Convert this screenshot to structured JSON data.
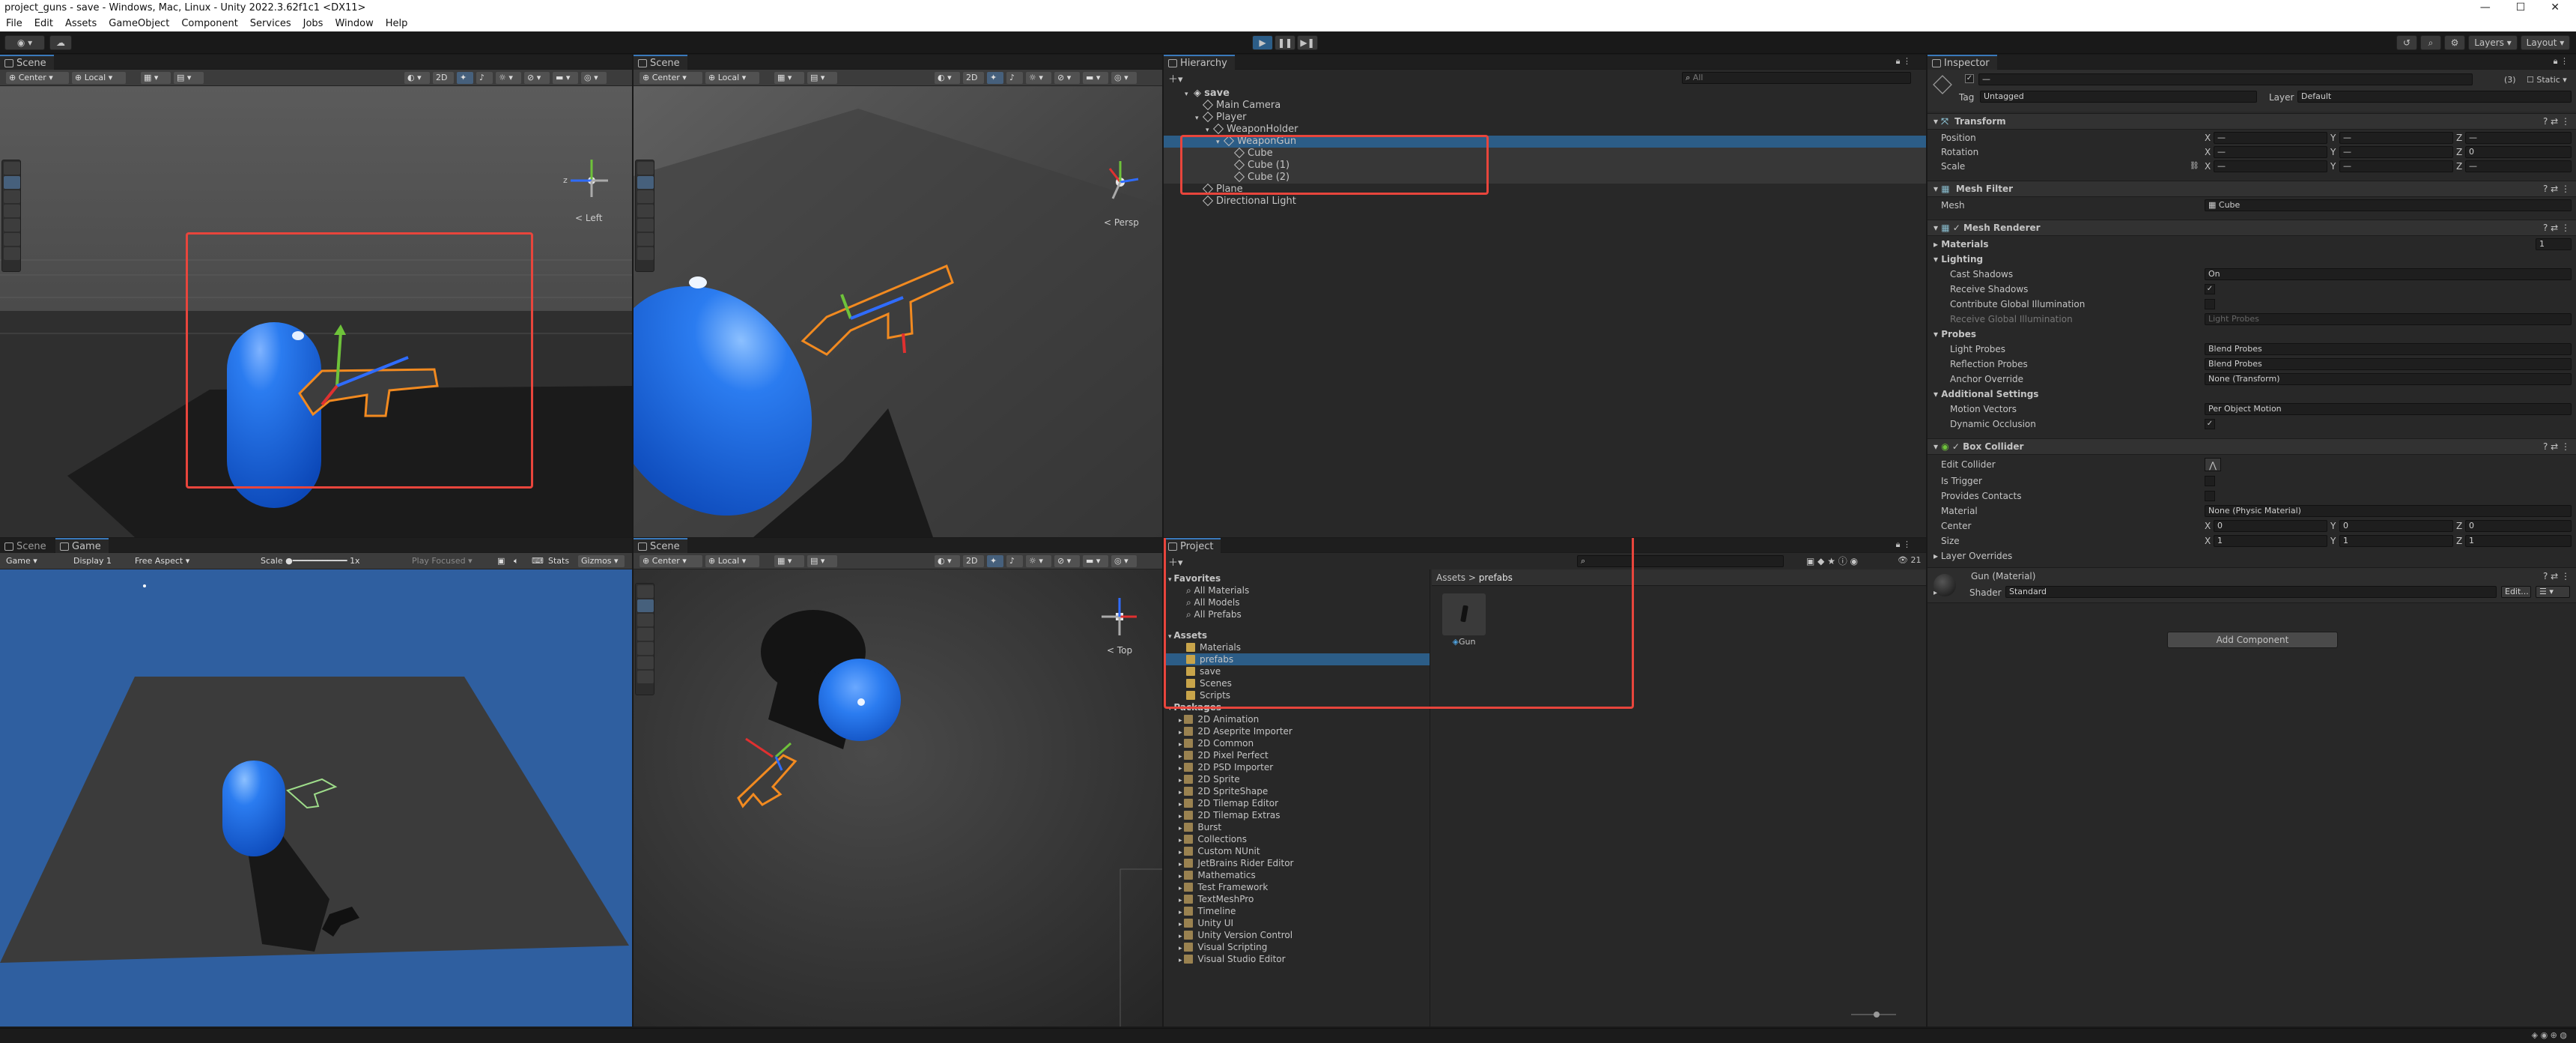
{
  "window": {
    "title": "project_guns - save - Windows, Mac, Linux - Unity 2022.3.62f1c1 <DX11>",
    "min": "—",
    "max": "☐",
    "close": "✕"
  },
  "menu": [
    "File",
    "Edit",
    "Assets",
    "GameObject",
    "Component",
    "Services",
    "Jobs",
    "Window",
    "Help"
  ],
  "toolbar": {
    "layers": "Layers",
    "layout": "Layout"
  },
  "scene_tl": {
    "tab": "Scene",
    "pivot": "Center",
    "space": "Local",
    "mode2d": "2D",
    "view": "< Left"
  },
  "scene_tr": {
    "tab": "Scene",
    "pivot": "Center",
    "space": "Local",
    "mode2d": "2D",
    "view": "< Persp"
  },
  "scene_br": {
    "tab": "Scene",
    "pivot": "Center",
    "space": "Local",
    "mode2d": "2D",
    "view": "< Top"
  },
  "game": {
    "tab_scene": "Scene",
    "tab_game": "Game",
    "display_mode": "Game",
    "display": "Display 1",
    "aspect": "Free Aspect",
    "scale_label": "Scale",
    "scale_value": "1x",
    "play_focused": "Play Focused",
    "stats": "Stats",
    "gizmos": "Gizmos"
  },
  "hierarchy": {
    "tab": "Hierarchy",
    "search_placeholder": "All",
    "items": [
      {
        "label": "save",
        "depth": 0,
        "kind": "scene"
      },
      {
        "label": "Main Camera",
        "depth": 1,
        "kind": "go"
      },
      {
        "label": "Player",
        "depth": 1,
        "kind": "go"
      },
      {
        "label": "WeaponHolder",
        "depth": 2,
        "kind": "go"
      },
      {
        "label": "WeaponGun",
        "depth": 3,
        "kind": "go"
      },
      {
        "label": "Cube",
        "depth": 4,
        "kind": "go"
      },
      {
        "label": "Cube (1)",
        "depth": 4,
        "kind": "go"
      },
      {
        "label": "Cube (2)",
        "depth": 4,
        "kind": "go"
      },
      {
        "label": "Plane",
        "depth": 1,
        "kind": "go"
      },
      {
        "label": "Directional Light",
        "depth": 1,
        "kind": "go"
      }
    ]
  },
  "project": {
    "tab": "Project",
    "count": "21",
    "breadcrumb_root": "Assets",
    "breadcrumb_sep": ">",
    "breadcrumb_leaf": "prefabs",
    "asset_name": "Gun",
    "favorites_label": "Favorites",
    "favorites": [
      "All Materials",
      "All Models",
      "All Prefabs"
    ],
    "assets_label": "Assets",
    "assets": [
      "Materials",
      "prefabs",
      "save",
      "Scenes",
      "Scripts"
    ],
    "packages_label": "Packages",
    "packages": [
      "2D Animation",
      "2D Aseprite Importer",
      "2D Common",
      "2D Pixel Perfect",
      "2D PSD Importer",
      "2D Sprite",
      "2D SpriteShape",
      "2D Tilemap Editor",
      "2D Tilemap Extras",
      "Burst",
      "Collections",
      "Custom NUnit",
      "JetBrains Rider Editor",
      "Mathematics",
      "Test Framework",
      "TextMeshPro",
      "Timeline",
      "Unity UI",
      "Unity Version Control",
      "Visual Scripting",
      "Visual Studio Editor"
    ]
  },
  "inspector": {
    "tab": "Inspector",
    "name": "—",
    "static": "Static",
    "badge": "(3)",
    "tag_label": "Tag",
    "tag": "Untagged",
    "layer_label": "Layer",
    "layer": "Default",
    "transform": {
      "title": "Transform",
      "position": "Position",
      "rotation": "Rotation",
      "scale": "Scale",
      "dash": "—",
      "rz": "0",
      "x": "X",
      "y": "Y",
      "z": "Z"
    },
    "mesh_filter": {
      "title": "Mesh Filter",
      "mesh_label": "Mesh",
      "mesh": "Cube"
    },
    "mesh_renderer": {
      "title": "Mesh Renderer",
      "materials": "Materials",
      "materials_count": "1",
      "lighting": "Lighting",
      "cast_shadows": "Cast Shadows",
      "cast_shadows_val": "On",
      "receive_shadows": "Receive Shadows",
      "contribute_gi": "Contribute Global Illumination",
      "receive_gi": "Receive Global Illumination",
      "receive_gi_val": "Light Probes",
      "probes": "Probes",
      "light_probes": "Light Probes",
      "light_probes_val": "Blend Probes",
      "reflection_probes": "Reflection Probes",
      "reflection_probes_val": "Blend Probes",
      "anchor_override": "Anchor Override",
      "anchor_override_val": "None (Transform)",
      "additional": "Additional Settings",
      "motion_vectors": "Motion Vectors",
      "motion_vectors_val": "Per Object Motion",
      "dynamic_occlusion": "Dynamic Occlusion"
    },
    "box_collider": {
      "title": "Box Collider",
      "edit_collider": "Edit Collider",
      "is_trigger": "Is Trigger",
      "provides_contacts": "Provides Contacts",
      "material": "Material",
      "material_val": "None (Physic Material)",
      "center": "Center",
      "size": "Size",
      "c0": "0",
      "s1": "1",
      "layer_overrides": "Layer Overrides"
    },
    "material": {
      "title": "Gun (Material)",
      "shader_label": "Shader",
      "shader": "Standard",
      "edit": "Edit..."
    },
    "add_component": "Add Component"
  },
  "colors": {
    "accent": "#3a79bb",
    "selection": "#2c5d87",
    "highlight": "#e8453c",
    "capsule": "#1f6fe0",
    "gun": "#f28a20"
  }
}
